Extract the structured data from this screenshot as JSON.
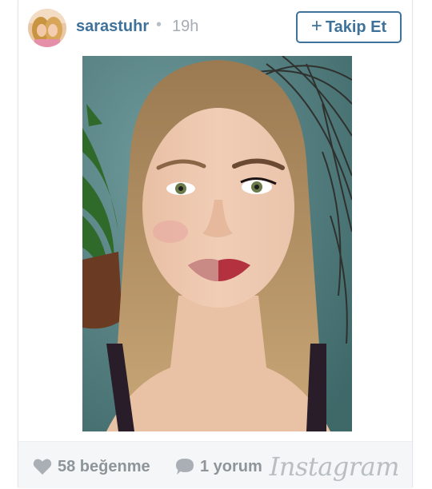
{
  "post": {
    "username": "sarastuhr",
    "separator": "•",
    "time": "19h",
    "follow_label": "Takip Et",
    "likes_label": "58 beğenme",
    "comments_label": "1 yorum",
    "brand": "Instagram"
  },
  "icons": {
    "follow": "plus-icon",
    "likes": "heart-icon",
    "comments": "speech-bubble-icon"
  },
  "colors": {
    "link_blue": "#3f729b",
    "muted_gray": "#8d959b",
    "footer_bg": "#f5f6f7"
  }
}
